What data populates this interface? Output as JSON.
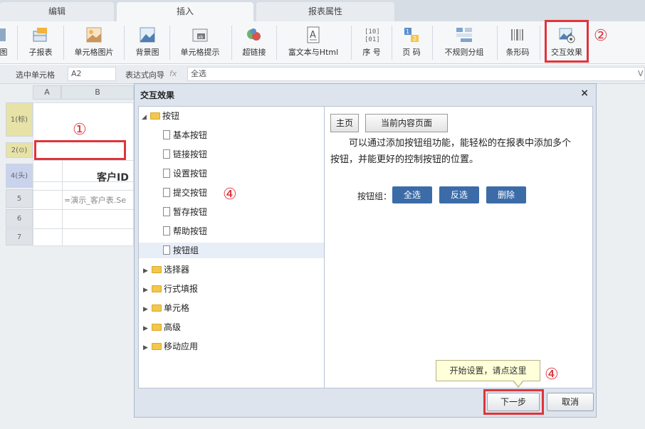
{
  "tabs": [
    {
      "label": "编辑"
    },
    {
      "label": "插入"
    },
    {
      "label": "报表属性"
    }
  ],
  "toolbar": {
    "items": [
      {
        "label": "图",
        "icon": "image-icon"
      },
      {
        "label": "子报表",
        "icon": "subreport-icon"
      },
      {
        "label": "单元格图片",
        "icon": "cell-image-icon"
      },
      {
        "label": "背景图",
        "icon": "background-image-icon"
      },
      {
        "label": "单元格提示",
        "icon": "cell-tip-icon"
      },
      {
        "label": "超链接",
        "icon": "hyperlink-icon"
      },
      {
        "label": "富文本与Html",
        "icon": "rich-text-icon"
      },
      {
        "label": "序 号",
        "icon": "sequence-icon"
      },
      {
        "label": "页 码",
        "icon": "page-number-icon"
      },
      {
        "label": "不规则分组",
        "icon": "irregular-group-icon"
      },
      {
        "label": "条形码",
        "icon": "barcode-icon"
      },
      {
        "label": "交互效果",
        "icon": "interaction-icon"
      }
    ],
    "marker": "②"
  },
  "formula_bar": {
    "cell_label": "选中单元格",
    "cell_value": "A2",
    "expr_label": "表达式向导",
    "fx": "fx",
    "expr_value": "全选",
    "chevron": "V"
  },
  "sheet": {
    "cols": [
      "A",
      "B"
    ],
    "rows": [
      "1(标)",
      "2(⊙)",
      "4(头)",
      "5",
      "6",
      "7"
    ],
    "header_text": "客户ID",
    "formula_text": "=演示_客户表.Se",
    "marker": "①"
  },
  "dialog": {
    "title": "交互效果",
    "close": "×",
    "marker": "④",
    "tree": {
      "root": {
        "label": "按钮",
        "arrow": "◢"
      },
      "children": [
        {
          "label": "基本按钮"
        },
        {
          "label": "链接按钮"
        },
        {
          "label": "设置按钮"
        },
        {
          "label": "提交按钮"
        },
        {
          "label": "暂存按钮"
        },
        {
          "label": "帮助按钮"
        },
        {
          "label": "按钮组"
        }
      ],
      "folders": [
        {
          "label": "选择器",
          "arrow": "▶"
        },
        {
          "label": "行式填报",
          "arrow": "▶"
        },
        {
          "label": "单元格",
          "arrow": "▶"
        },
        {
          "label": "高级",
          "arrow": "▶"
        },
        {
          "label": "移动应用",
          "arrow": "▶"
        }
      ]
    },
    "content": {
      "home_btn": "主页",
      "current_btn": "当前内容页面",
      "description": "可以通过添加按钮组功能，能轻松的在报表中添加多个按钮，并能更好的控制按钮的位置。",
      "group_label": "按钮组：",
      "buttons": [
        {
          "label": "全选"
        },
        {
          "label": "反选"
        },
        {
          "label": "删除"
        }
      ]
    },
    "tooltip": "开始设置，请点这里",
    "next_btn": "下一步",
    "cancel_btn": "取消"
  },
  "colors": {
    "accent_red": "#e0343a",
    "button_blue": "#3c6ca8",
    "tooltip_bg": "#ffffd9"
  }
}
